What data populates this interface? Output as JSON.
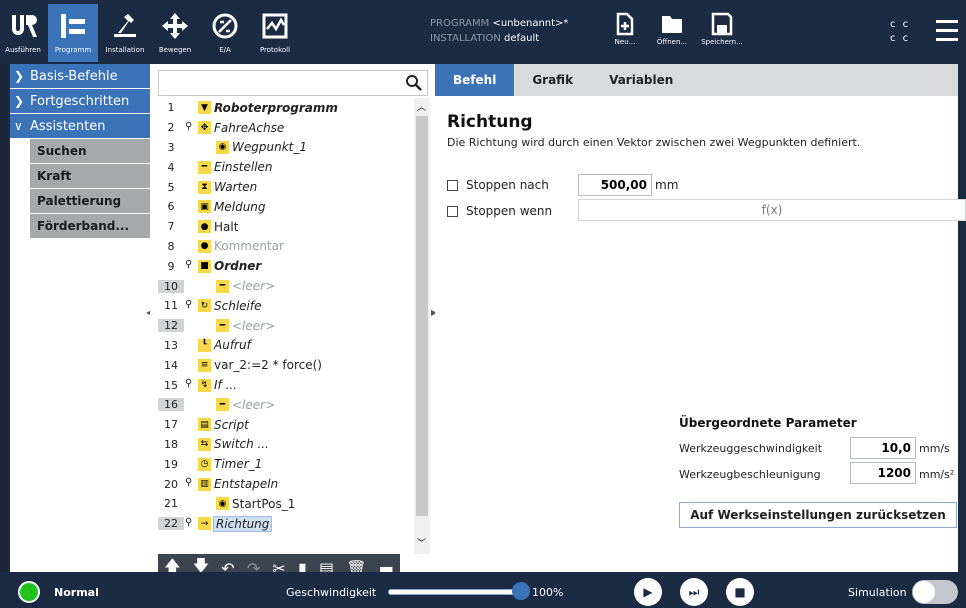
{
  "header": {
    "tabs": [
      {
        "label": "Ausführen",
        "icon": "ur-logo-icon"
      },
      {
        "label": "Programm",
        "icon": "program-icon"
      },
      {
        "label": "Installation",
        "icon": "installation-icon"
      },
      {
        "label": "Bewegen",
        "icon": "move-arrows-icon"
      },
      {
        "label": "E/A",
        "icon": "io-icon"
      },
      {
        "label": "Protokoll",
        "icon": "log-icon"
      }
    ],
    "program_label": "PROGRAMM",
    "program_value": "<unbenannt>*",
    "installation_label": "INSTALLATION",
    "installation_value": "default",
    "file_buttons": [
      "Neu...",
      "Öffnen...",
      "Speichern..."
    ],
    "cc": [
      "c c",
      "c c"
    ]
  },
  "sidebar": {
    "categories": [
      {
        "label": "Basis-Befehle",
        "expanded": false
      },
      {
        "label": "Fortgeschritten",
        "expanded": false
      },
      {
        "label": "Assistenten",
        "expanded": true
      }
    ],
    "assistants": [
      "Suchen",
      "Kraft",
      "Palettierung",
      "Förderband..."
    ]
  },
  "tree": {
    "rows": [
      {
        "n": "1",
        "label": "Roboterprogramm",
        "icon": "▼",
        "style": "bold-italic",
        "indent": 0
      },
      {
        "n": "2",
        "label": "FahreAchse",
        "icon": "✥",
        "style": "italic",
        "indent": 1,
        "pin": true
      },
      {
        "n": "3",
        "label": "Wegpunkt_1",
        "icon": "◉",
        "style": "italic",
        "indent": 2
      },
      {
        "n": "4",
        "label": "Einstellen",
        "icon": "━",
        "style": "italic",
        "indent": 1
      },
      {
        "n": "5",
        "label": "Warten",
        "icon": "⧗",
        "style": "italic",
        "indent": 1
      },
      {
        "n": "6",
        "label": "Meldung",
        "icon": "▣",
        "style": "italic",
        "indent": 1
      },
      {
        "n": "7",
        "label": "Halt",
        "icon": "●",
        "style": "normal",
        "indent": 1
      },
      {
        "n": "8",
        "label": "Kommentar",
        "icon": "●",
        "style": "dim",
        "indent": 1
      },
      {
        "n": "9",
        "label": "Ordner",
        "icon": "■",
        "style": "bold-italic",
        "indent": 1,
        "pin": true
      },
      {
        "n": "10",
        "label": "<leer>",
        "icon": "━",
        "style": "dim-italic",
        "indent": 2,
        "grey": true
      },
      {
        "n": "11",
        "label": "Schleife",
        "icon": "↻",
        "style": "italic",
        "indent": 1,
        "pin": true
      },
      {
        "n": "12",
        "label": "<leer>",
        "icon": "━",
        "style": "dim-italic",
        "indent": 2,
        "grey": true
      },
      {
        "n": "13",
        "label": "Aufruf",
        "icon": "┖",
        "style": "italic",
        "indent": 1
      },
      {
        "n": "14",
        "label": "var_2:=2 * force()",
        "icon": "≡",
        "style": "normal",
        "indent": 1
      },
      {
        "n": "15",
        "label": "If ...",
        "icon": "↯",
        "style": "italic",
        "indent": 1,
        "pin": true
      },
      {
        "n": "16",
        "label": "<leer>",
        "icon": "━",
        "style": "dim-italic",
        "indent": 2,
        "grey": true
      },
      {
        "n": "17",
        "label": "Script",
        "icon": "▤",
        "style": "italic",
        "indent": 1
      },
      {
        "n": "18",
        "label": "Switch ...",
        "icon": "⇆",
        "style": "italic",
        "indent": 1
      },
      {
        "n": "19",
        "label": "Timer_1",
        "icon": "◷",
        "style": "italic",
        "indent": 1
      },
      {
        "n": "20",
        "label": "Entstapeln",
        "icon": "▥",
        "style": "italic",
        "indent": 1,
        "pin": true
      },
      {
        "n": "21",
        "label": "StartPos_1",
        "icon": "◉",
        "style": "normal",
        "indent": 2
      },
      {
        "n": "22",
        "label": "Richtung",
        "icon": "→",
        "style": "italic-selected",
        "indent": 1,
        "pin": true,
        "grey": true
      }
    ],
    "toolbar": [
      "up-arrow-icon",
      "down-arrow-icon",
      "undo-icon",
      "redo-icon",
      "cut-icon",
      "copy-icon",
      "paste-icon",
      "delete-icon",
      "suppress-icon"
    ]
  },
  "panel": {
    "tabs": [
      "Befehl",
      "Grafik",
      "Variablen"
    ],
    "active_tab": "Befehl",
    "title": "Richtung",
    "description": "Die Richtung wird durch einen Vektor zwischen zwei Wegpunkten definiert.",
    "stop_after_label": "Stoppen nach",
    "stop_after_value": "500,00",
    "stop_after_unit": "mm",
    "stop_when_label": "Stoppen wenn",
    "stop_when_value": "f(x)",
    "params_title": "Übergeordnete Parameter",
    "tool_speed_label": "Werkzeuggeschwindigkeit",
    "tool_speed_value": "10,0",
    "tool_speed_unit": "mm/s",
    "tool_accel_label": "Werkzeugbeschleunigung",
    "tool_accel_value": "1200",
    "tool_accel_unit": "mm/s²",
    "reset_button": "Auf Werkseinstellungen zurücksetzen"
  },
  "footer": {
    "status": "Normal",
    "speed_label": "Geschwindigkeit",
    "speed_value": "100%",
    "speed_fraction": 1.0,
    "simulation_label": "Simulation"
  },
  "colors": {
    "accent": "#3a73b7",
    "nav": "#1b2b44",
    "node_yellow": "#f6d94b",
    "status_green": "#20c21b"
  }
}
